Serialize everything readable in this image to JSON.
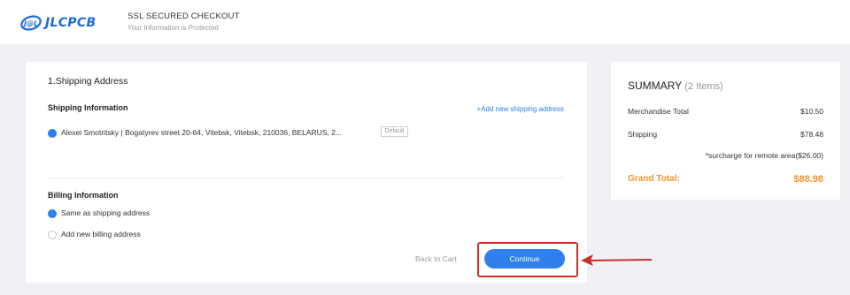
{
  "header": {
    "logo_text": "JLCPCB",
    "ssl_title": "SSL SECURED CHECKOUT",
    "ssl_subtitle": "Your Information is Protected"
  },
  "shipping": {
    "section_title": "1.Shipping Address",
    "info_title": "Shipping Information",
    "add_link": "+Add new shipping address",
    "address": "Alexei Smotritsky | Bogatyrev street 20-64, Vitebsk, Vitebsk, 210036, BELARUS, 2...",
    "default_badge": "Default"
  },
  "billing": {
    "title": "Billing Information",
    "options": [
      {
        "label": "Same as shipping address",
        "selected": true
      },
      {
        "label": "Add new billing address",
        "selected": false
      }
    ]
  },
  "actions": {
    "back_label": "Back to Cart",
    "continue_label": "Continue"
  },
  "summary": {
    "title": "SUMMARY",
    "count": "(2 Items)",
    "merch_label": "Merchandise Total",
    "merch_value": "$10.50",
    "shipping_label": "Shipping",
    "shipping_value": "$78.48",
    "surcharge_note": "*surcharge for remote area($26.00)",
    "grand_label": "Grand Total:",
    "grand_value": "$88.98"
  },
  "colors": {
    "accent": "#2f80ed",
    "grand_total": "#f5922b",
    "highlight": "#c8302a"
  }
}
